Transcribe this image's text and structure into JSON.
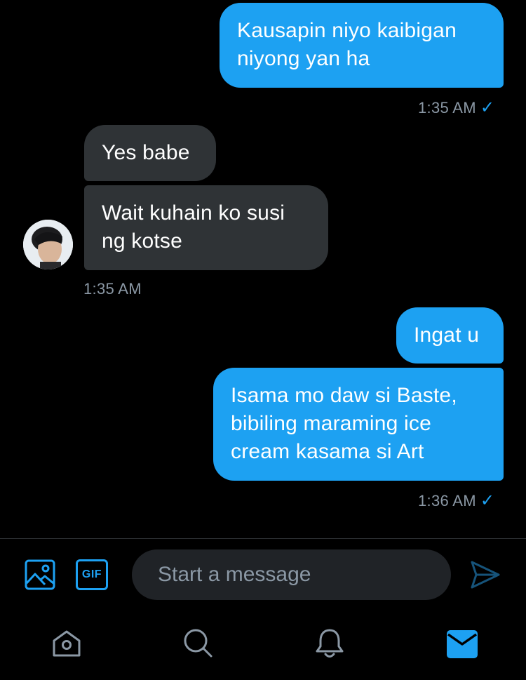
{
  "messages": [
    {
      "text": "Kausapin niyo kaibigan\nniyong yan ha",
      "direction": "sent"
    },
    {
      "text": "Yes babe",
      "direction": "received"
    },
    {
      "text": "Wait kuhain ko susi\nng kotse",
      "direction": "received"
    },
    {
      "text": "Ingat u",
      "direction": "sent"
    },
    {
      "text": "Isama mo daw si Baste,\nbibiling maraming ice\ncream kasama si Art",
      "direction": "sent"
    }
  ],
  "timestamps": {
    "t1": "1:35 AM",
    "t2": "1:35 AM",
    "t3": "1:36 AM"
  },
  "read_check": "✓",
  "composer": {
    "placeholder": "Start a message",
    "gif_label": "GIF"
  },
  "icons": {
    "image": "image-icon",
    "gif": "gif-icon",
    "send": "send-icon",
    "home": "home-icon",
    "search": "search-icon",
    "notifications": "bell-icon",
    "messages": "mail-icon"
  },
  "colors": {
    "accent": "#1da1f2",
    "received_bubble": "#2f3336",
    "muted": "#8b98a5",
    "background": "#000000"
  }
}
